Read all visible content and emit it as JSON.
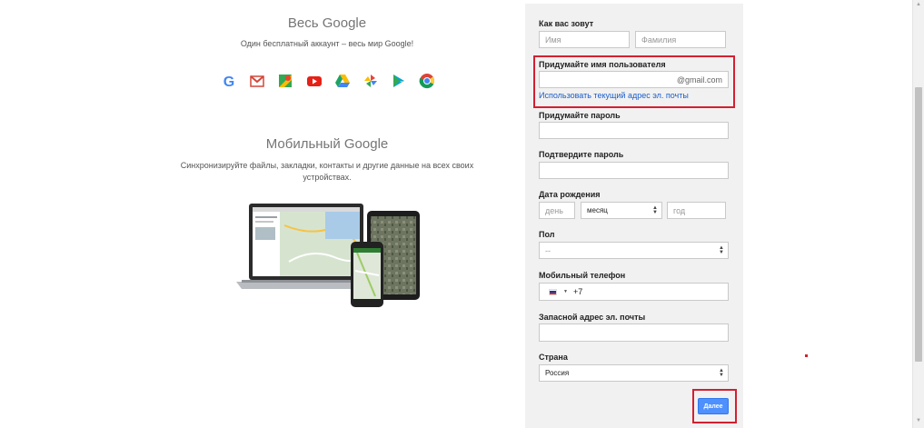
{
  "promo": {
    "title1": "Весь Google",
    "subtitle1": "Один бесплатный аккаунт – весь мир Google!",
    "icons": [
      "google-g-icon",
      "gmail-icon",
      "maps-icon",
      "youtube-icon",
      "drive-icon",
      "photos-icon",
      "play-store-icon",
      "chrome-icon"
    ],
    "title2": "Мобильный Google",
    "subtitle2": "Синхронизируйте файлы, закладки, контакты и другие данные на всех своих устройствах."
  },
  "form": {
    "name_label": "Как вас зовут",
    "first_name_placeholder": "Имя",
    "last_name_placeholder": "Фамилия",
    "username_label": "Придумайте имя пользователя",
    "username_value": "",
    "username_suffix": "@gmail.com",
    "use_current_email_link": "Использовать текущий адрес эл. почты",
    "password_label": "Придумайте пароль",
    "confirm_password_label": "Подтвердите пароль",
    "birthdate_label": "Дата рождения",
    "day_placeholder": "день",
    "month_value": "месяц",
    "year_placeholder": "год",
    "gender_label": "Пол",
    "gender_value": "--",
    "phone_label": "Мобильный телефон",
    "phone_prefix": "+7",
    "backup_email_label": "Запасной адрес эл. почты",
    "country_label": "Страна",
    "country_value": "Россия",
    "next_button": "Далее"
  },
  "colors": {
    "accent_blue": "#4d90fe",
    "link_blue": "#1a5dc9",
    "highlight_red": "#d32031",
    "panel_bg": "#f1f1f1"
  }
}
